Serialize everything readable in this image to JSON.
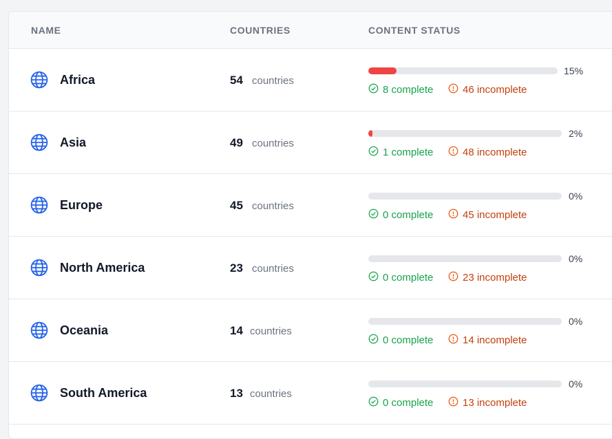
{
  "headers": {
    "name": "NAME",
    "countries": "COUNTRIES",
    "status": "CONTENT STATUS"
  },
  "colors": {
    "accent": "#2563eb",
    "bar_fill": "#ef4444",
    "complete": "#16a34a",
    "incomplete": "#c2410c"
  },
  "rows": [
    {
      "name": "Africa",
      "count": "54",
      "count_label": "countries",
      "pct_label": "15%",
      "progress": 15,
      "complete": "8 complete",
      "incomplete": "46 incomplete"
    },
    {
      "name": "Asia",
      "count": "49",
      "count_label": "countries",
      "pct_label": "2%",
      "progress": 2,
      "complete": "1 complete",
      "incomplete": "48 incomplete"
    },
    {
      "name": "Europe",
      "count": "45",
      "count_label": "countries",
      "pct_label": "0%",
      "progress": 0,
      "complete": "0 complete",
      "incomplete": "45 incomplete"
    },
    {
      "name": "North America",
      "count": "23",
      "count_label": "countries",
      "pct_label": "0%",
      "progress": 0,
      "complete": "0 complete",
      "incomplete": "23 incomplete"
    },
    {
      "name": "Oceania",
      "count": "14",
      "count_label": "countries",
      "pct_label": "0%",
      "progress": 0,
      "complete": "0 complete",
      "incomplete": "14 incomplete"
    },
    {
      "name": "South America",
      "count": "13",
      "count_label": "countries",
      "pct_label": "0%",
      "progress": 0,
      "complete": "0 complete",
      "incomplete": "13 incomplete"
    }
  ]
}
